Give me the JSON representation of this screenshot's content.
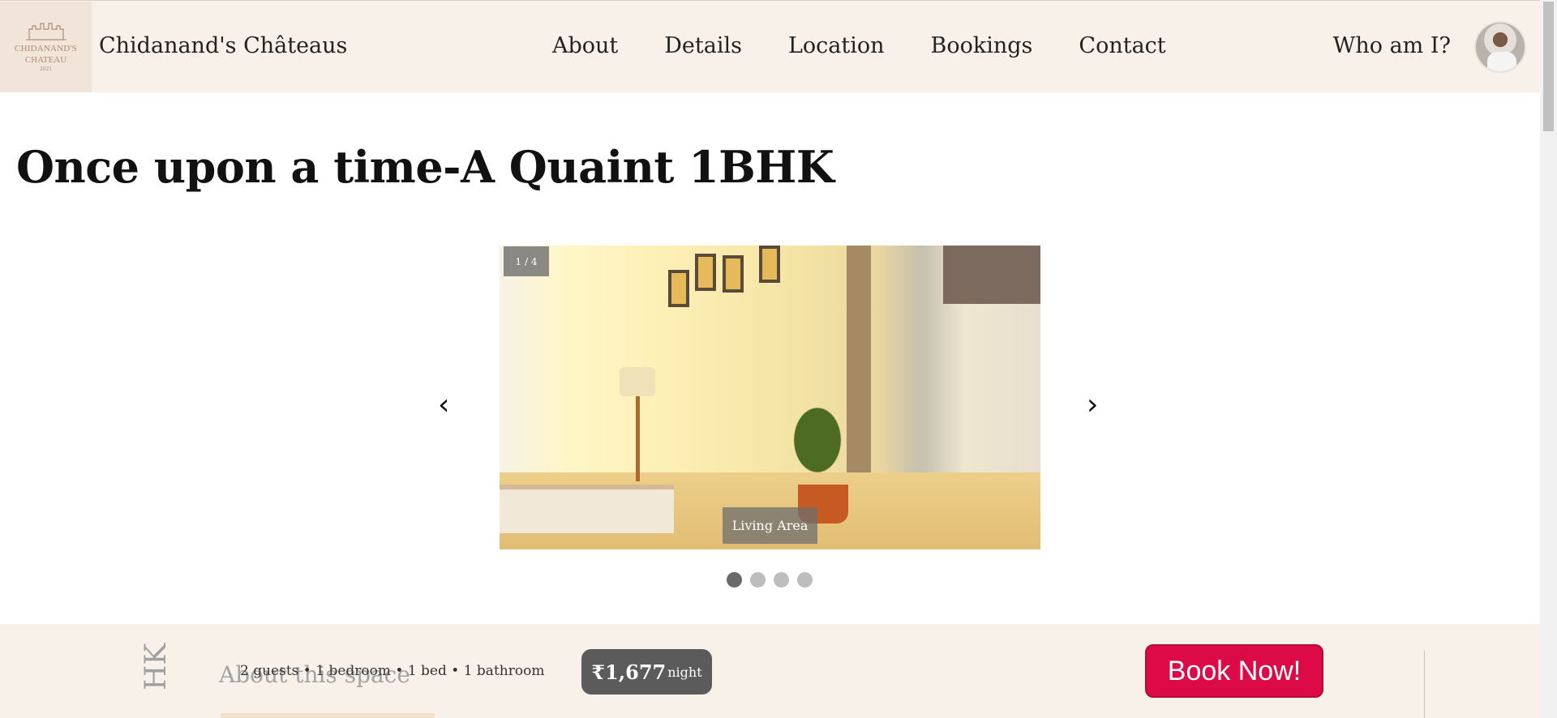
{
  "header": {
    "logo": {
      "line1": "CHIDANAND'S",
      "line2": "CHATEAU",
      "line3": "2021"
    },
    "brand": "Chidanand's Châteaus",
    "nav": [
      "About",
      "Details",
      "Location",
      "Bookings",
      "Contact"
    ],
    "who": "Who am I?"
  },
  "page": {
    "title": "Once upon a time-A Quaint 1BHK"
  },
  "carousel": {
    "counter": "1 / 4",
    "caption": "Living Area",
    "prev_icon": "‹",
    "next_icon": "›",
    "slides": 4,
    "active_slide": 1
  },
  "bottom": {
    "vertical_text": "HK",
    "about_heading": "About this space",
    "stats": "2 guests • 1 bedroom • 1 bed • 1 bathroom",
    "price_amount": "₹1,677",
    "price_unit": "night",
    "book_label": "Book Now!"
  },
  "colors": {
    "accent": "#dc0a47",
    "header_bg": "#f8f1ea",
    "price_bg": "#5b5b5b"
  }
}
